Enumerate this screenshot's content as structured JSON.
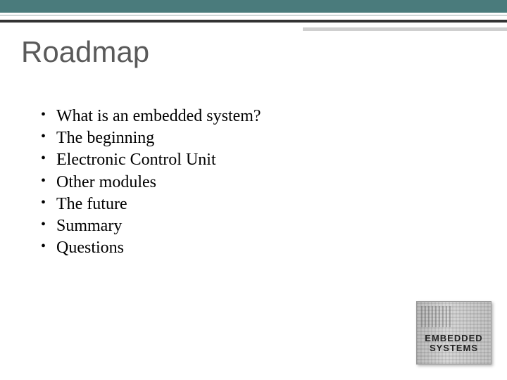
{
  "title": "Roadmap",
  "bullets": [
    "What is an embedded system?",
    "The beginning",
    "Electronic Control Unit",
    "Other modules",
    "The future",
    "Summary",
    "Questions"
  ],
  "logo": {
    "line1": "EMBEDDED",
    "line2": "SYSTEMS"
  }
}
